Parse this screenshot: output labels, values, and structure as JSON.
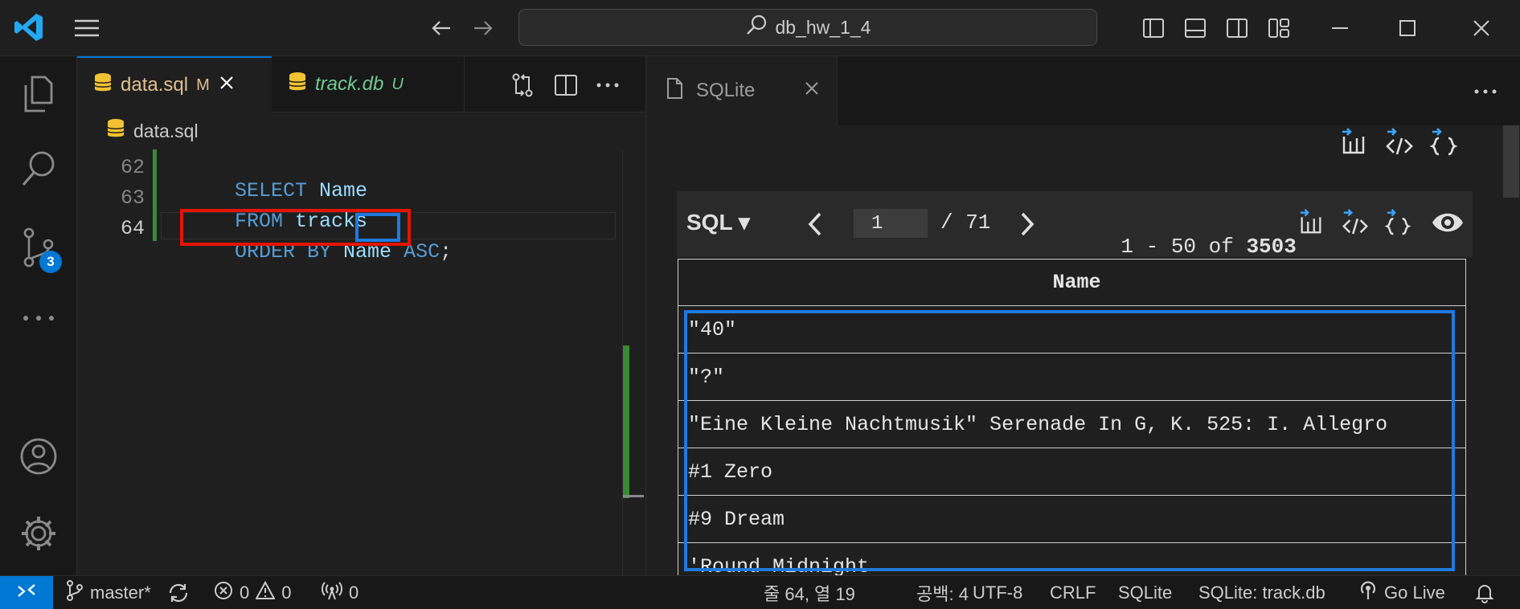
{
  "titlebar": {
    "search_text": "db_hw_1_4"
  },
  "activitybar": {
    "source_control_badge": "3"
  },
  "editor_group1": {
    "tabs": [
      {
        "label": "data.sql",
        "status": "M"
      },
      {
        "label": "track.db",
        "status": "U"
      }
    ],
    "breadcrumb": "data.sql",
    "lines": [
      {
        "number": "62",
        "keyword1": "SELECT",
        "rest1": " Name"
      },
      {
        "number": "63",
        "keyword1": "FROM",
        "rest1": " tracks"
      },
      {
        "number": "64",
        "keyword1": "ORDER BY",
        "rest1": " Name ",
        "keyword2": "ASC",
        "rest2": ";"
      }
    ]
  },
  "editor_group2": {
    "tab_label": "SQLite",
    "toolbar": {
      "mode": "SQL ▾",
      "page": "1",
      "total_pages": "/ 71",
      "range": "1 - 50 of ",
      "total_rows": "3503"
    },
    "table": {
      "columns": [
        "Name"
      ],
      "rows": [
        "\"40\"",
        "\"?\"",
        "\"Eine Kleine Nachtmusik\" Serenade In G, K. 525: I. Allegro",
        "#1 Zero",
        "#9 Dream",
        "'Round Midnight"
      ]
    }
  },
  "statusbar": {
    "branch": "master*",
    "errors": "0",
    "warnings": "0",
    "ports": "0",
    "cursor": "줄 64, 열 19",
    "spaces": "공백: 4",
    "encoding": "UTF-8",
    "eol": "CRLF",
    "language": "SQLite",
    "db": "SQLite: track.db",
    "golive": "Go Live"
  },
  "colors": {
    "accent_blue": "#0078d4",
    "annotation_red": "#e51400",
    "annotation_blue": "#1f7ae0",
    "modified": "#e2c08d",
    "untracked": "#73c991"
  }
}
